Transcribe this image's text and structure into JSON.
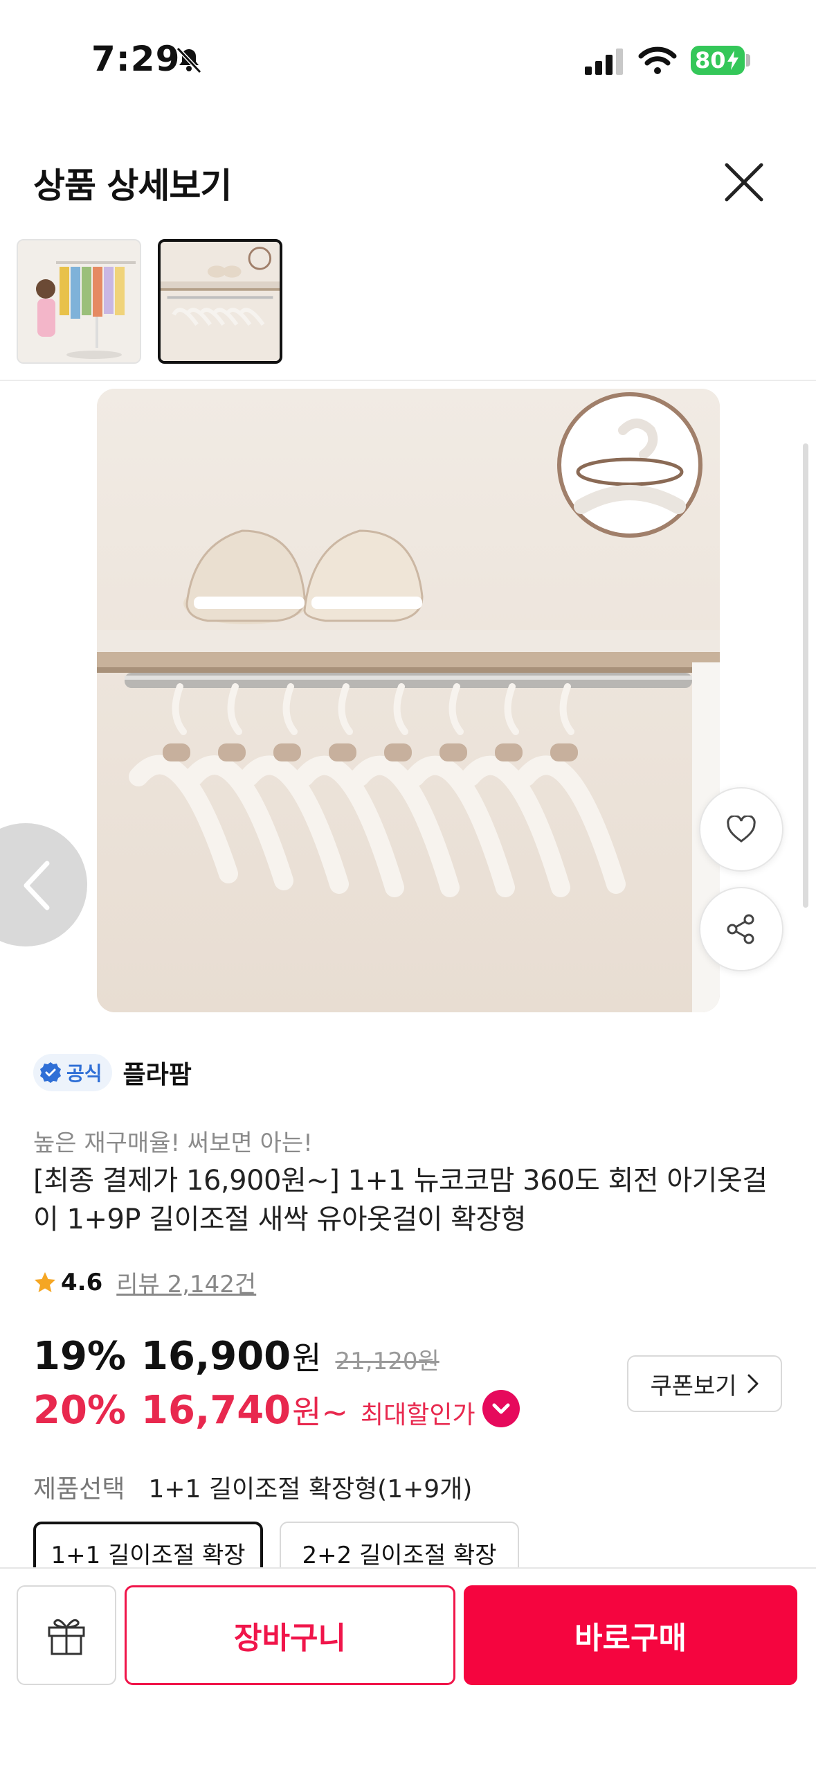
{
  "status_bar": {
    "time": "7:29",
    "battery": "80"
  },
  "header": {
    "title": "상품 상세보기"
  },
  "product": {
    "official_badge": "공식",
    "brand": "플라팜",
    "tagline": "높은 재구매율! 써보면 아는!",
    "title": "[최종 결제가 16,900원~] 1+1 뉴코코맘 360도 회전 아기옷걸이 1+9P 길이조절 새싹 유아옷걸이 확장형",
    "rating": "4.6",
    "review_label": "리뷰 2,142건"
  },
  "price": {
    "discount": "19%",
    "amount": "16,900",
    "won": "원",
    "original": "21,120원",
    "max_discount": "20%",
    "max_amount": "16,740",
    "max_won": "원~",
    "max_label": "최대할인가",
    "coupon_label": "쿠폰보기"
  },
  "options": {
    "label": "제품선택",
    "selected": "1+1 길이조절 확장형(1+9개)",
    "choices": [
      "1+1 길이조절 확장",
      "2+2 길이조절 확장"
    ]
  },
  "actions": {
    "cart": "장바구니",
    "buy": "바로구매"
  },
  "colors": {
    "accent": "#f5053f",
    "discount_red": "#e8284e",
    "official_blue": "#2f6fd6",
    "star": "#f5a623"
  }
}
